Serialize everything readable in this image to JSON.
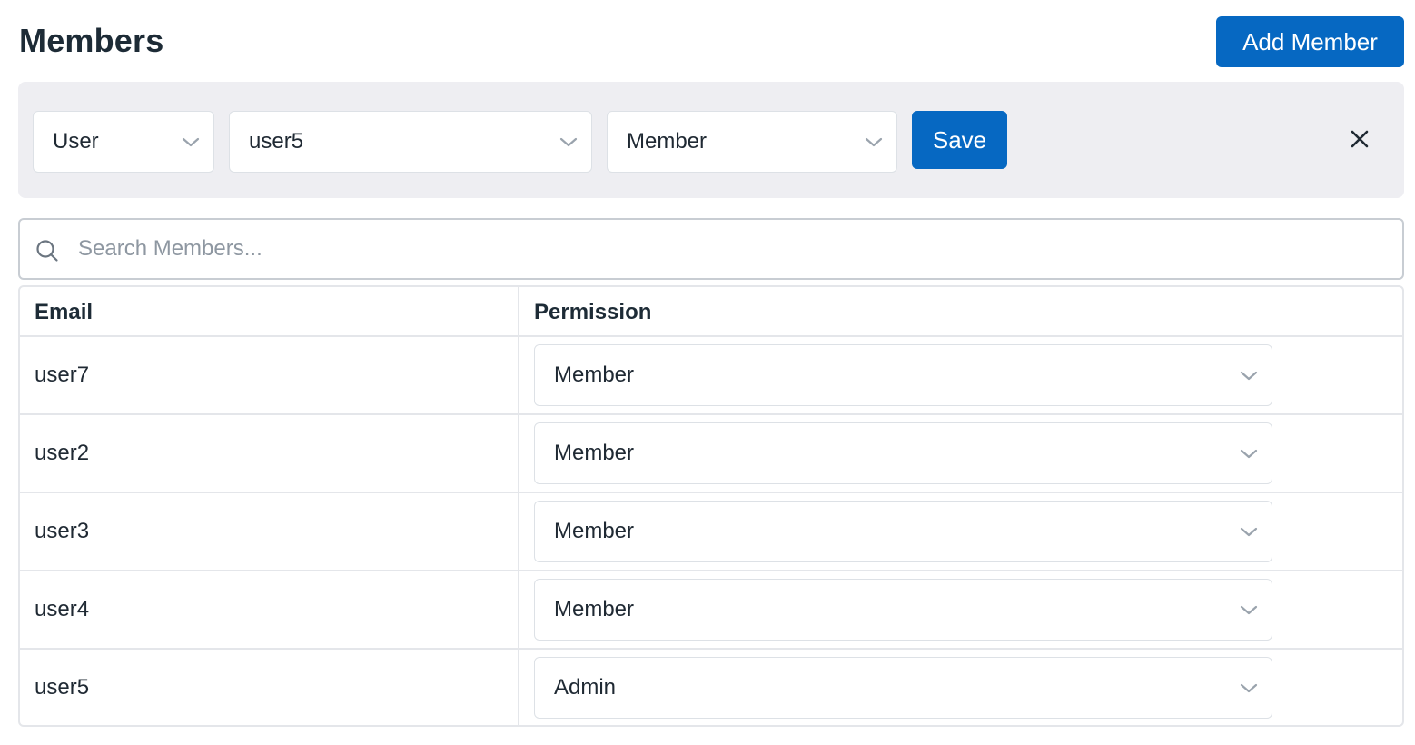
{
  "header": {
    "title": "Members",
    "add_button_label": "Add Member"
  },
  "editor": {
    "type_value": "User",
    "user_value": "user5",
    "permission_value": "Member",
    "save_label": "Save"
  },
  "search": {
    "placeholder": "Search Members..."
  },
  "table": {
    "columns": [
      "Email",
      "Permission"
    ],
    "rows": [
      {
        "email": "user7",
        "permission": "Member"
      },
      {
        "email": "user2",
        "permission": "Member"
      },
      {
        "email": "user3",
        "permission": "Member"
      },
      {
        "email": "user4",
        "permission": "Member"
      },
      {
        "email": "user5",
        "permission": "Admin"
      }
    ]
  },
  "colors": {
    "primary": "#0668c2",
    "panel": "#eeeef2",
    "border": "#e4e6ea"
  }
}
